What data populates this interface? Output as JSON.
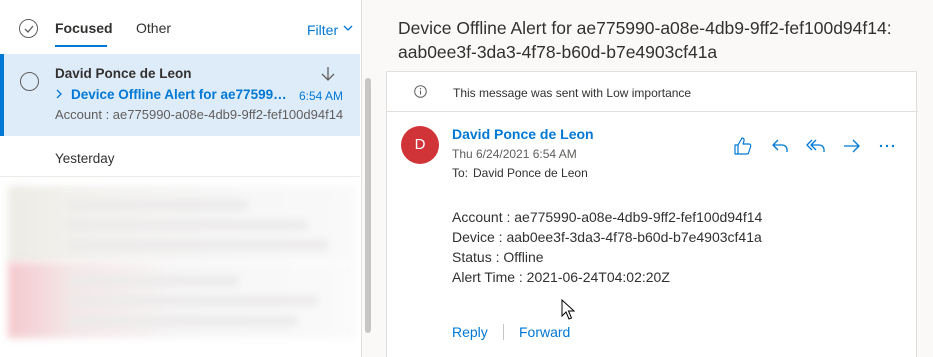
{
  "tabs": {
    "focused": "Focused",
    "other": "Other",
    "filter": "Filter"
  },
  "message_list": {
    "selected": {
      "sender": "David Ponce de Leon",
      "subject": "Device Offline Alert for ae775990-a08e-4db9-9ff2-fef100d94f14: aab0ee3f-3da3-4f78-b60d-b7e4903cf41a",
      "time": "6:54 AM",
      "preview": "Account : ae775990-a08e-4db9-9ff2-fef100d94f14"
    },
    "group_label": "Yesterday"
  },
  "reading_pane": {
    "title": "Device Offline Alert for ae775990-a08e-4db9-9ff2-fef100d94f14: aab0ee3f-3da3-4f78-b60d-b7e4903cf41a",
    "importance_notice": "This message was sent with Low importance",
    "avatar_initial": "D",
    "sender": "David Ponce de Leon",
    "date": "Thu 6/24/2021 6:54 AM",
    "to_label": "To:",
    "to_value": "David Ponce de Leon",
    "body": [
      "Account : ae775990-a08e-4db9-9ff2-fef100d94f14",
      "Device : aab0ee3f-3da3-4f78-b60d-b7e4903cf41a",
      "Status : Offline",
      "Alert Time : 2021-06-24T04:02:20Z"
    ],
    "reply_label": "Reply",
    "forward_label": "Forward"
  },
  "icons": {
    "select_all": "checkmark-circle-icon",
    "filter": "chevron-down-icon",
    "move": "arrow-down-icon",
    "info": "info-icon",
    "like": "thumbs-up-icon",
    "reply": "reply-icon",
    "reply_all": "reply-all-icon",
    "forward": "forward-arrow-icon",
    "more": "more-horizontal-icon"
  },
  "colors": {
    "accent": "#0078d4",
    "selected_bg": "#deecf9",
    "avatar": "#d13438"
  }
}
